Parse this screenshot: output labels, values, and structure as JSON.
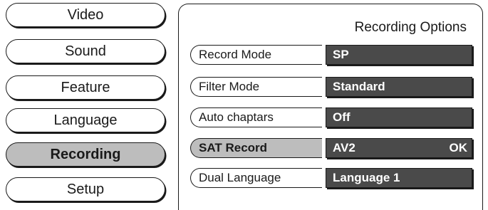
{
  "menu": {
    "items": [
      {
        "label": "Video"
      },
      {
        "label": "Sound"
      },
      {
        "label": "Feature"
      },
      {
        "label": "Language"
      },
      {
        "label": "Recording",
        "selected": true
      },
      {
        "label": "Setup"
      }
    ]
  },
  "panel": {
    "title": "Recording Options",
    "options": [
      {
        "label": "Record Mode",
        "value": "SP",
        "confirm": ""
      },
      {
        "label": "Filter Mode",
        "value": "Standard",
        "confirm": ""
      },
      {
        "label": "Auto chaptars",
        "value": "Off",
        "confirm": ""
      },
      {
        "label": "SAT Record",
        "value": "AV2",
        "confirm": "OK",
        "selected": true
      },
      {
        "label": "Dual Language",
        "value": "Language 1",
        "confirm": ""
      }
    ]
  },
  "colors": {
    "selected_background": "#bdbdbd",
    "value_background": "#4a4a4a",
    "outline": "#1a1a1a"
  }
}
